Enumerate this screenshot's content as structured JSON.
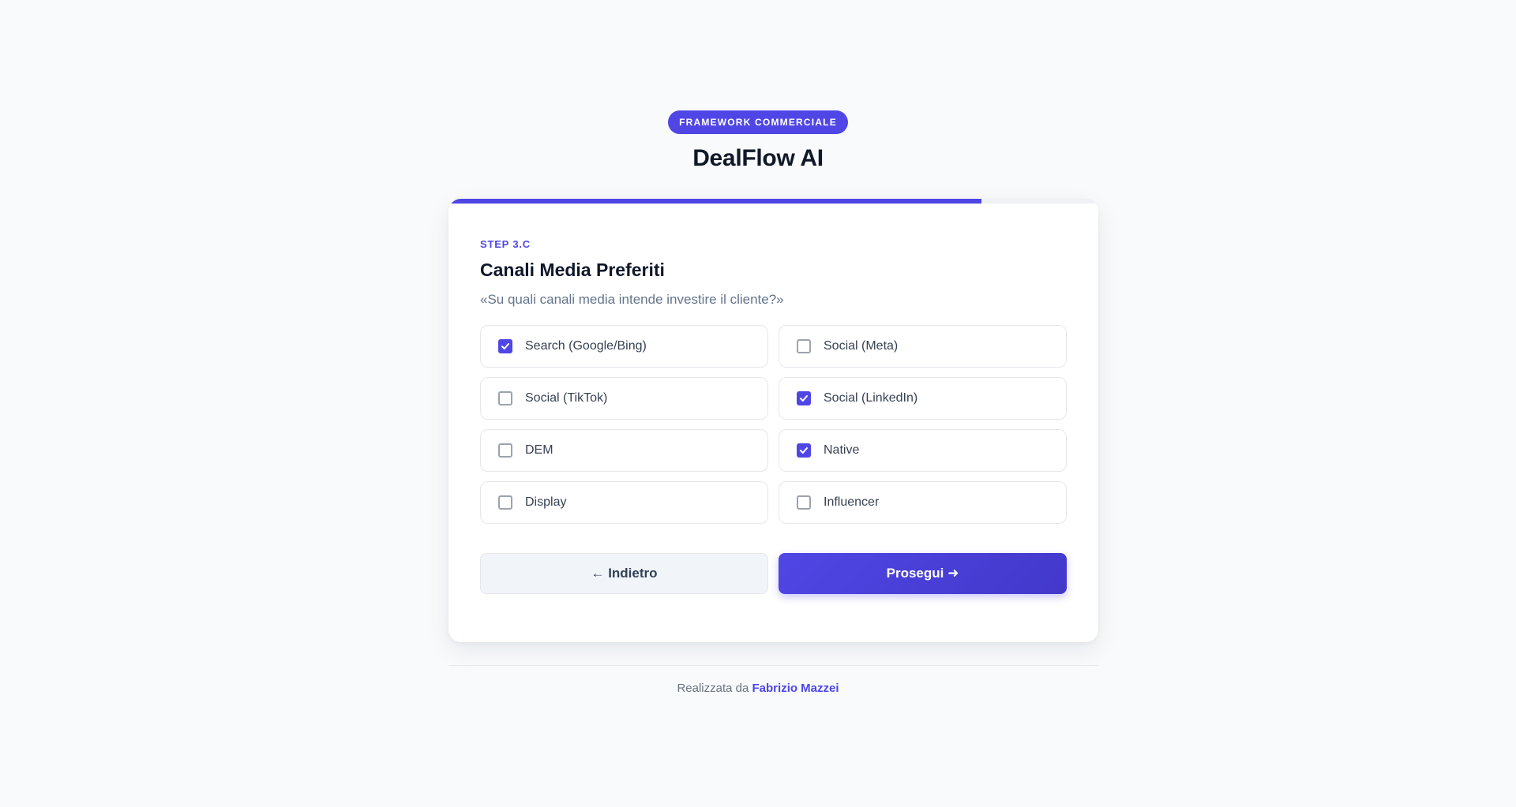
{
  "header": {
    "badge": "FRAMEWORK COMMERCIALE",
    "title": "DealFlow AI"
  },
  "progress": {
    "fraction": 0.82
  },
  "step": {
    "label": "STEP 3.C",
    "title": "Canali Media Preferiti",
    "question": "«Su quali canali media intende investire il cliente?»"
  },
  "options": [
    {
      "label": "Search (Google/Bing)",
      "checked": true
    },
    {
      "label": "Social (Meta)",
      "checked": false
    },
    {
      "label": "Social (TikTok)",
      "checked": false
    },
    {
      "label": "Social (LinkedIn)",
      "checked": true
    },
    {
      "label": "DEM",
      "checked": false
    },
    {
      "label": "Native",
      "checked": true
    },
    {
      "label": "Display",
      "checked": false
    },
    {
      "label": "Influencer",
      "checked": false
    }
  ],
  "actions": {
    "back_label": "← Indietro",
    "next_label": "Prosegui ➜"
  },
  "footer": {
    "prefix": "Realizzata da",
    "author": "Fabrizio Mazzei"
  },
  "colors": {
    "accent": "#4f46e5",
    "background": "#f8fafc"
  }
}
